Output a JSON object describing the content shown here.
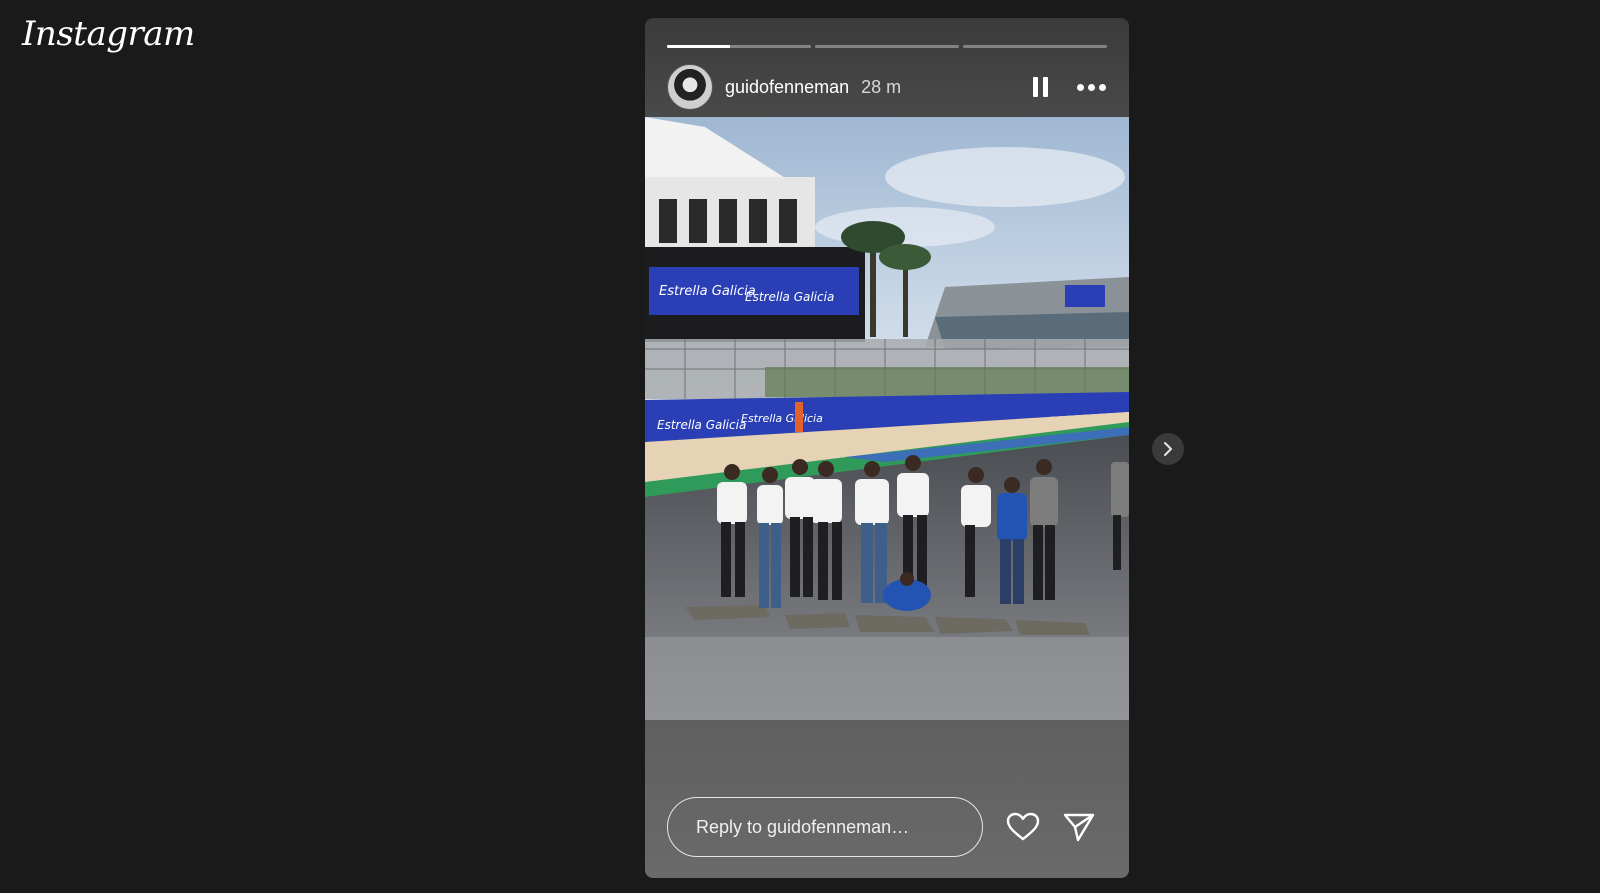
{
  "app": {
    "logo_text": "Instagram"
  },
  "story": {
    "progress": {
      "segments": 3,
      "current_segment": 1,
      "current_fraction": 0.44
    },
    "author": {
      "username": "guidofenneman",
      "time_ago": "28 m"
    },
    "controls": {
      "pause_icon": "pause-icon",
      "more_icon": "more-options-icon"
    },
    "media": {
      "banner_text": "Estrella Galicia"
    },
    "reply": {
      "placeholder": "Reply to guidofenneman…"
    },
    "actions": {
      "like_icon": "heart-icon",
      "share_icon": "paper-plane-icon"
    }
  },
  "navigation": {
    "next_icon": "chevron-right-icon"
  },
  "colors": {
    "background": "#1a1a1a",
    "sponsor_blue": "#2a3fb5",
    "track_green": "#2f9a5a"
  }
}
